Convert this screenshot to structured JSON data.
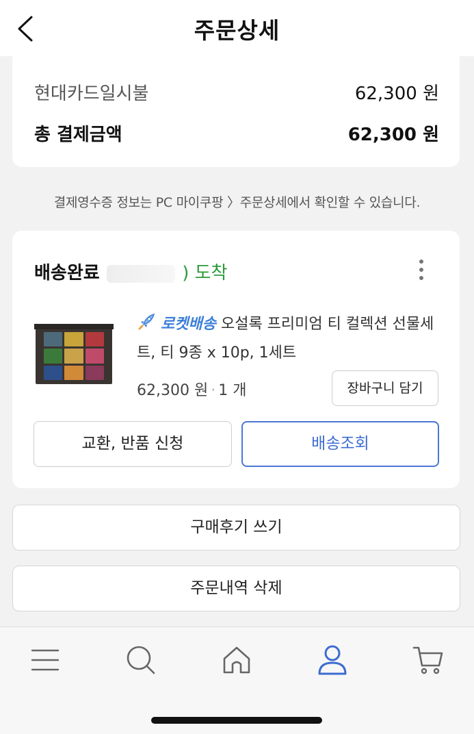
{
  "header": {
    "title": "주문상세"
  },
  "payment": {
    "method_label": "현대카드일시불",
    "method_amount": "62,300 원",
    "total_label": "총 결제금액",
    "total_amount": "62,300 원"
  },
  "notice": "결제영수증 정보는 PC 마이쿠팡 〉주문상세에서 확인할 수 있습니다.",
  "order": {
    "status": "배송완료",
    "date_suffix": ") 도착",
    "rocket_label": "로켓배송",
    "product_name": "오설록 프리미엄 티 컬렉션 선물세트, 티 9종 x 10p, 1세트",
    "price": "62,300 원",
    "separator": "·",
    "quantity": "1 개",
    "add_to_cart_label": "장바구니 담기",
    "exchange_label": "교환, 반품 신청",
    "track_label": "배송조회",
    "thumb_colors": [
      "#4d6a7a",
      "#c8a43a",
      "#b23a3e",
      "#3b7a3a",
      "#c9a24a",
      "#c04a6a",
      "#2d4f8a",
      "#d18a38",
      "#8a3a5a"
    ]
  },
  "actions": {
    "review_label": "구매후기 쓰기",
    "delete_label": "주문내역 삭제"
  },
  "colors": {
    "accent_blue": "#4a76d4",
    "arrive_green": "#2c9a3a",
    "rocket_blue": "#3d7fd8"
  },
  "tabbar": {
    "items": [
      "menu-icon",
      "search-icon",
      "home-icon",
      "my-page-icon",
      "cart-icon"
    ],
    "active": "my-page-icon"
  }
}
